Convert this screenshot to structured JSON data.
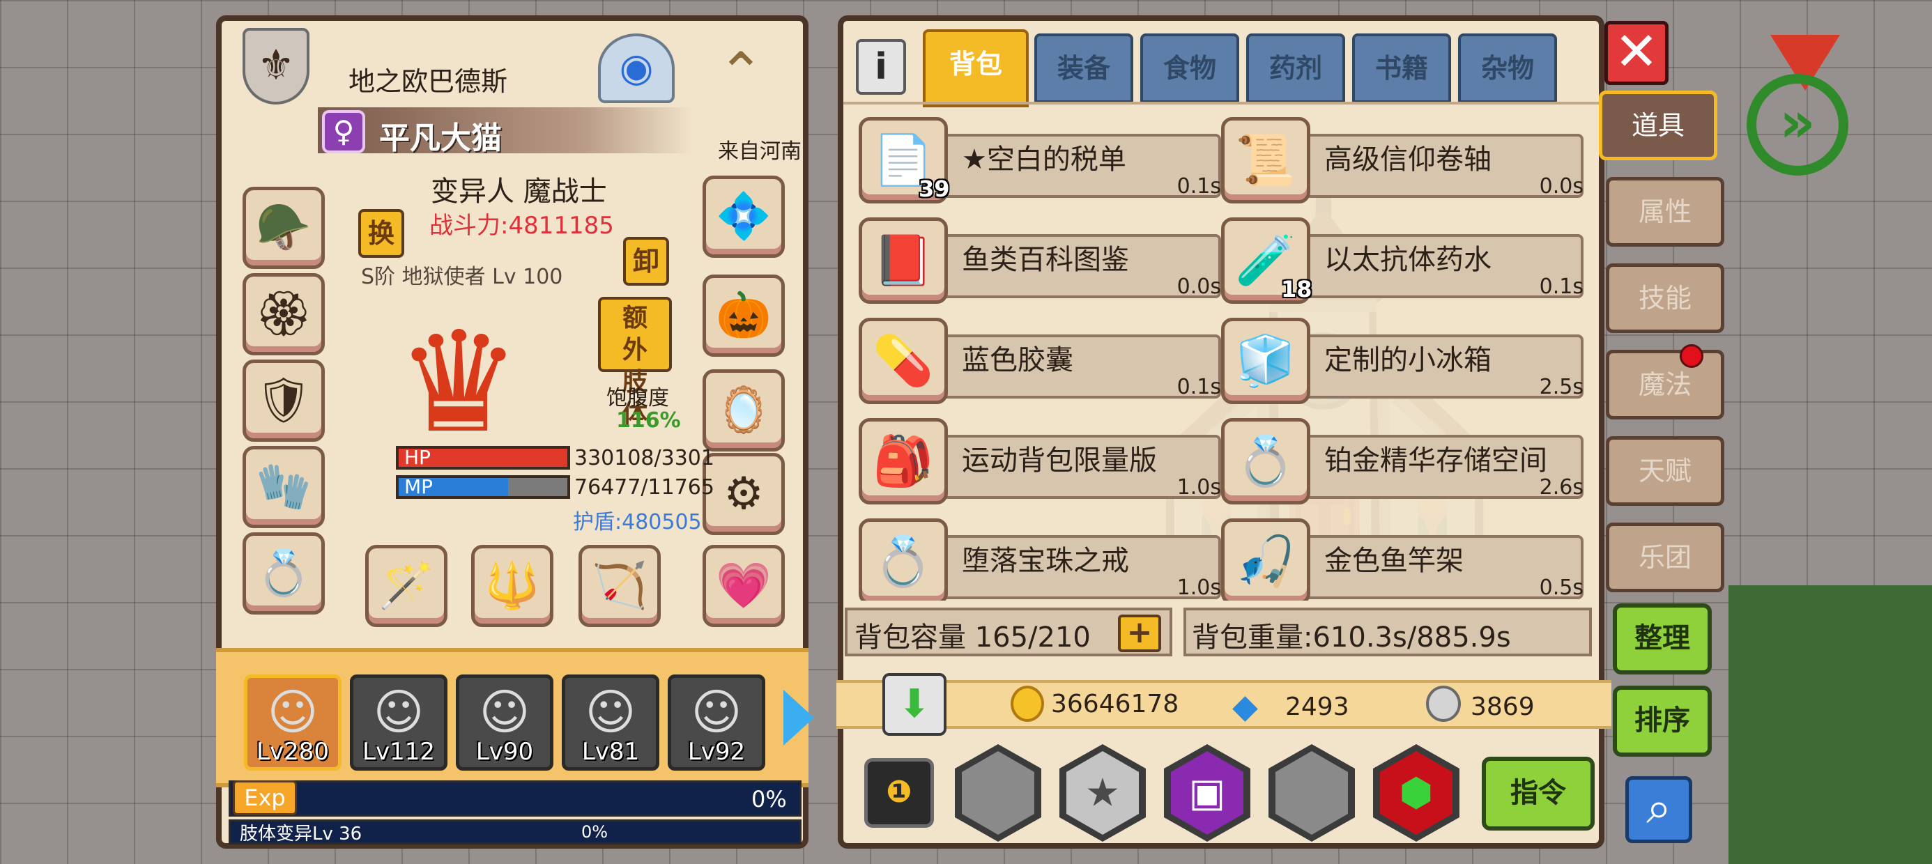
{
  "character": {
    "guild_title": "地之欧巴德斯",
    "name": "平凡大猫",
    "gender_symbol": "♀",
    "origin": "来自河南",
    "class_name": "变异人 魔战士",
    "combat_power": "战斗力:4811185",
    "pet_label": "S阶 地狱使者 Lv 100",
    "swap_label": "换",
    "unequip_label": "卸",
    "extra_limb_label": "额外肢体",
    "satiety_label": "饱腹度",
    "satiety_value": "116%",
    "hp_label": "HP",
    "hp_value": "330108/3301",
    "hp_fraction": 1.0,
    "mp_label": "MP",
    "mp_value": "76477/11765",
    "mp_fraction": 0.65,
    "shield": "护盾:480505"
  },
  "party": [
    {
      "level": "Lv280",
      "selected": true
    },
    {
      "level": "Lv112",
      "selected": false
    },
    {
      "level": "Lv90",
      "selected": false
    },
    {
      "level": "Lv81",
      "selected": false
    },
    {
      "level": "Lv92",
      "selected": false
    }
  ],
  "exp": {
    "label": "Exp",
    "percent": "0%",
    "mutation_label": "肢体变异Lv 36",
    "mutation_percent": "0%"
  },
  "tabs": [
    "背包",
    "装备",
    "食物",
    "药剂",
    "书籍",
    "杂物"
  ],
  "info_icon": "i",
  "items": [
    {
      "name": "★空白的税单",
      "time": "0.1s",
      "count": "39",
      "icon": "tax-form-icon",
      "glyph": "📄"
    },
    {
      "name": "高级信仰卷轴",
      "time": "0.0s",
      "count": "",
      "icon": "scroll-icon",
      "glyph": "📜"
    },
    {
      "name": "鱼类百科图鉴",
      "time": "0.0s",
      "count": "",
      "icon": "book-icon",
      "glyph": "📕"
    },
    {
      "name": "以太抗体药水",
      "time": "0.1s",
      "count": "18",
      "icon": "potion-icon",
      "glyph": "🧪"
    },
    {
      "name": "蓝色胶囊",
      "time": "0.1s",
      "count": "",
      "icon": "capsule-icon",
      "glyph": "💊"
    },
    {
      "name": "定制的小冰箱",
      "time": "2.5s",
      "count": "",
      "icon": "fridge-icon",
      "glyph": "🧊"
    },
    {
      "name": "运动背包限量版",
      "time": "1.0s",
      "count": "",
      "icon": "backpack-icon",
      "glyph": "🎒"
    },
    {
      "name": "铂金精华存储空间",
      "time": "2.6s",
      "count": "",
      "icon": "ring-icon",
      "glyph": "💍"
    },
    {
      "name": "堕落宝珠之戒",
      "time": "1.0s",
      "count": "",
      "icon": "ring-icon",
      "glyph": "💍"
    },
    {
      "name": "金色鱼竿架",
      "time": "0.5s",
      "count": "",
      "icon": "rod-rack-icon",
      "glyph": "🎣"
    }
  ],
  "capacity": "背包容量 165/210",
  "weight": "背包重量:610.3s/885.9s",
  "currency": {
    "gold": "36646178",
    "diamond": "2493",
    "silver": "3869"
  },
  "side_tabs": [
    "道具",
    "属性",
    "技能",
    "魔法",
    "天赋",
    "乐团"
  ],
  "buttons": {
    "organize": "整理",
    "sort": "排序",
    "command": "指令"
  },
  "colors": {
    "panel": "#f2e4cb",
    "border": "#4a3526",
    "tab_active": "#f5bb27",
    "tab": "#5c7ea8",
    "green_button": "#8fd13a"
  }
}
